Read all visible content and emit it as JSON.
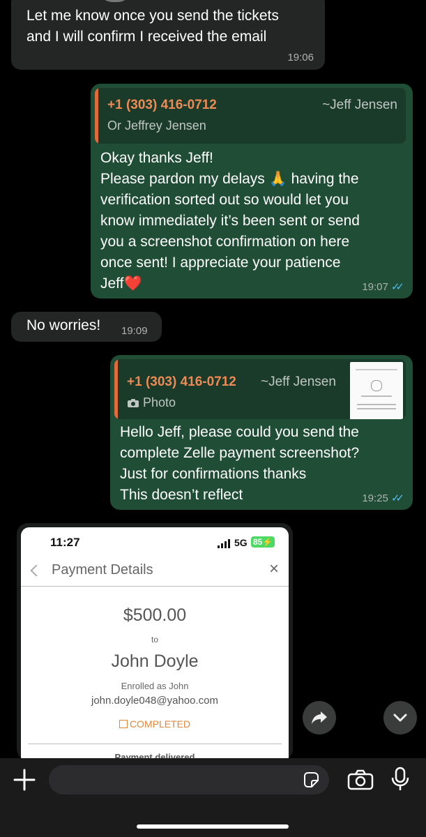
{
  "messages": {
    "m1": {
      "text": "Let me know once you send the tickets\nand I will confirm I received the email",
      "time": "19:06"
    },
    "m2": {
      "quote_phone": "+1 (303) 416-0712",
      "quote_name": "~Jeff Jensen",
      "quote_text": "Or Jeffrey Jensen",
      "text": "Okay thanks Jeff!\nPlease pardon my delays 🙏 having the\nverification sorted out so would let you\nknow immediately it’s been sent or send\nyou a screenshot confirmation on here\nonce sent! I appreciate your patience\nJeff❤️",
      "time": "19:07"
    },
    "m3": {
      "text": "No worries!",
      "time": "19:09"
    },
    "m4": {
      "quote_phone": "+1 (303) 416-0712",
      "quote_name": "~Jeff Jensen",
      "quote_type": "Photo",
      "text": "Hello Jeff, please could you send the\ncomplete Zelle payment screenshot?\nJust for confirmations thanks\nThis doesn’t reflect",
      "time": "19:25"
    }
  },
  "screenshot": {
    "clock": "11:27",
    "network": "5G",
    "battery": "85",
    "title": "Payment Details",
    "amount": "$500.00",
    "to": "to",
    "recipient": "John Doyle",
    "enrolled": "Enrolled as John",
    "email": "john.doyle048@yahoo.com",
    "status": "COMPLETED",
    "footer": "Payment delivered"
  },
  "icons": [
    "plus-icon",
    "sticker-icon",
    "camera-icon",
    "microphone-icon",
    "forward-icon",
    "chevron-down-icon"
  ]
}
